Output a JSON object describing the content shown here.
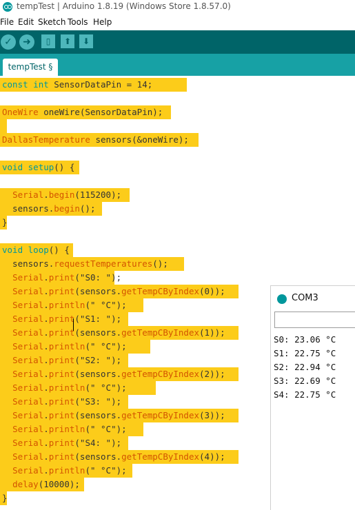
{
  "window": {
    "title": "tempTest | Arduino 1.8.19 (Windows Store 1.8.57.0)"
  },
  "menu": {
    "file": "File",
    "edit": "Edit",
    "sketch": "Sketch",
    "tools": "Tools",
    "help": "Help"
  },
  "toolbar": {
    "verify_icon": "checkmark-icon",
    "upload_icon": "arrow-right-icon",
    "new_icon": "new-file-icon",
    "open_icon": "arrow-up-icon",
    "save_icon": "arrow-down-icon"
  },
  "tabs": [
    {
      "label": "tempTest §"
    }
  ],
  "code": {
    "l0": "const int SensorDataPin = 14;",
    "l2": "OneWire oneWire(SensorDataPin);",
    "l4": "DallasTemperature sensors(&oneWire);",
    "l6": "void setup() {",
    "l8": "  Serial.begin(115200);",
    "l9": "  sensors.begin();",
    "l10": "}",
    "l12": "void loop() {",
    "l13": "  sensors.requestTemperatures();",
    "l14": "  Serial.print(\"S0: \");",
    "l15": "  Serial.print(sensors.getTempCByIndex(0));",
    "l16": "  Serial.println(\" °C\");",
    "l17": "  Serial.print(\"S1: \");",
    "l18": "  Serial.print(sensors.getTempCByIndex(1));",
    "l19": "  Serial.println(\" °C\");",
    "l20": "  Serial.print(\"S2: \");",
    "l21": "  Serial.print(sensors.getTempCByIndex(2));",
    "l22": "  Serial.println(\" °C\");",
    "l23": "  Serial.print(\"S3: \");",
    "l24": "  Serial.print(sensors.getTempCByIndex(3));",
    "l25": "  Serial.println(\" °C\");",
    "l26": "  Serial.print(\"S4: \");",
    "l27": "  Serial.print(sensors.getTempCByIndex(4));",
    "l28": "  Serial.println(\" °C\");",
    "l29": "  delay(10000);",
    "l30": "}"
  },
  "serial_monitor": {
    "title": "COM3",
    "input_value": "",
    "lines": [
      "S0: 23.06 °C",
      "S1: 22.75 °C",
      "S2: 22.94 °C",
      "S3: 22.69 °C",
      "S4: 22.75 °C"
    ]
  },
  "colors": {
    "toolbar": "#006468",
    "tabbar": "#17a1a5",
    "highlight": "#fccc1a"
  }
}
